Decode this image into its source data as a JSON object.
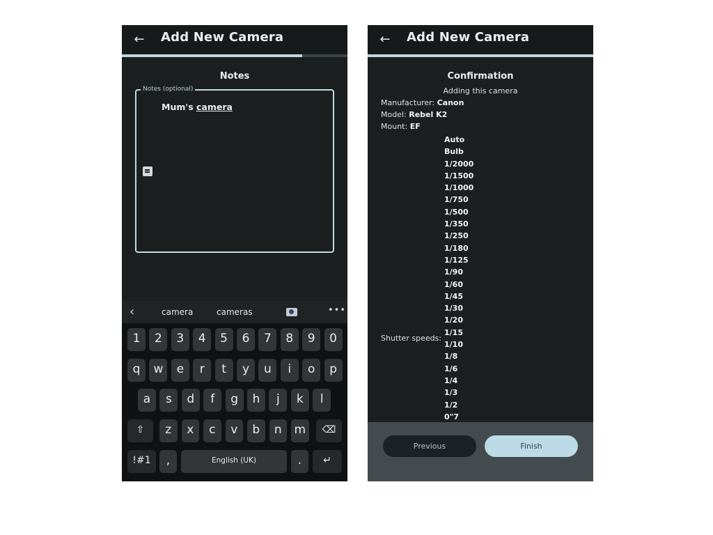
{
  "left_screen": {
    "appbar": {
      "back_icon": "arrow-left-icon",
      "title": "Add New Camera"
    },
    "progress": {
      "fraction": 0.8
    },
    "section_title": "Notes",
    "notes_field": {
      "label": "Notes (optional)",
      "value_plain": "Mum's ",
      "value_underlined": "camera",
      "icon": "sticky-note-icon"
    },
    "keyboard": {
      "suggestions": [
        "camera",
        "cameras"
      ],
      "suggestion_emoji": "camera-emoji",
      "back_icon": "chevron-left-icon",
      "more_icon": "more-dots",
      "more_label": "•••",
      "rows": [
        [
          "1",
          "2",
          "3",
          "4",
          "5",
          "6",
          "7",
          "8",
          "9",
          "0"
        ],
        [
          "q",
          "w",
          "e",
          "r",
          "t",
          "y",
          "u",
          "i",
          "o",
          "p"
        ],
        [
          "a",
          "s",
          "d",
          "f",
          "g",
          "h",
          "j",
          "k",
          "l"
        ],
        [
          "z",
          "x",
          "c",
          "v",
          "b",
          "n",
          "m"
        ]
      ],
      "shift_label": "⇧",
      "backspace_label": "⌫",
      "symbols_label": "!#1",
      "comma_label": ",",
      "space_label": "English (UK)",
      "period_label": ".",
      "enter_label": "↵"
    }
  },
  "right_screen": {
    "appbar": {
      "back_icon": "arrow-left-icon",
      "title": "Add New Camera"
    },
    "progress": {
      "fraction": 1.0
    },
    "section_title": "Confirmation",
    "subtitle": "Adding this camera",
    "manufacturer": {
      "label": "Manufacturer: ",
      "value": "Canon"
    },
    "model": {
      "label": "Model: ",
      "value": "Rebel K2"
    },
    "mount": {
      "label": "Mount: ",
      "value": "EF"
    },
    "shutter_label": "Shutter speeds:",
    "shutter_speeds": [
      "Auto",
      "Bulb",
      "1/2000",
      "1/1500",
      "1/1000",
      "1/750",
      "1/500",
      "1/350",
      "1/250",
      "1/180",
      "1/125",
      "1/90",
      "1/60",
      "1/45",
      "1/30",
      "1/20",
      "1/15",
      "1/10",
      "1/8",
      "1/6",
      "1/4",
      "1/3",
      "1/2",
      "0\"7"
    ],
    "buttons": {
      "previous": "Previous",
      "finish": "Finish"
    }
  },
  "colors": {
    "accent": "#bcdbe6",
    "background": "#1b1f20",
    "bottom_bar": "#434b4e"
  }
}
